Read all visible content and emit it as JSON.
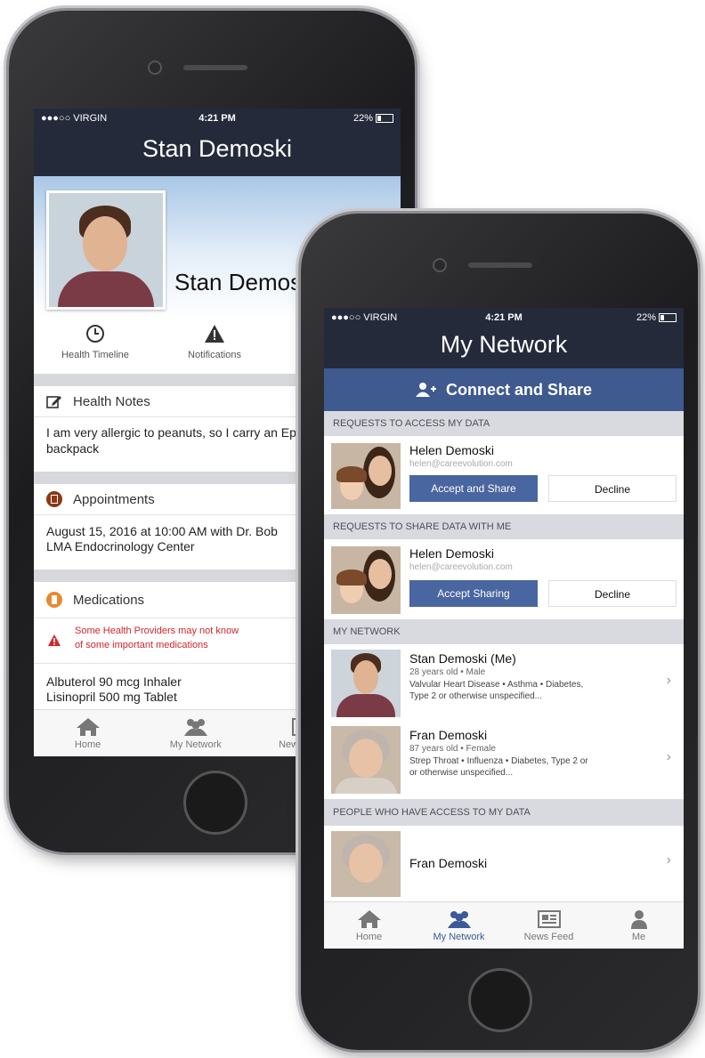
{
  "back_phone": {
    "status": {
      "carrier": "●●●○○ VIRGIN",
      "time": "4:21 PM",
      "battery": "22%"
    },
    "title": "Stan Demoski",
    "profile_name": "Stan Demoski",
    "quick_actions": [
      {
        "label": "Health Timeline",
        "icon": "clock-icon"
      },
      {
        "label": "Notifications",
        "icon": "warning-icon"
      }
    ],
    "health_notes": {
      "title": "Health Notes",
      "text": "I am very allergic to peanuts, so I carry an EpiPen in my backpack"
    },
    "appointments": {
      "title": "Appointments",
      "line1": "August 15, 2016 at 10:00 AM with Dr. Bob",
      "line2": "LMA Endocrinology Center"
    },
    "medications": {
      "title": "Medications",
      "warning_line1": "Some Health Providers may not know",
      "warning_line2": "of some important medications",
      "items": [
        "Albuterol 90 mcg Inhaler",
        "Lisinopril 500 mg Tablet"
      ]
    },
    "tabs": [
      "Home",
      "My Network",
      "News Feed"
    ]
  },
  "front_phone": {
    "status": {
      "carrier": "●●●○○ VIRGIN",
      "time": "4:21 PM",
      "battery": "22%"
    },
    "title": "My Network",
    "connect_label": "Connect and Share",
    "sections": {
      "requests_access": "REQUESTS TO ACCESS MY DATA",
      "requests_share": "REQUESTS TO SHARE DATA WITH ME",
      "my_network": "MY NETWORK",
      "people_access": "PEOPLE WHO HAVE ACCESS TO MY DATA"
    },
    "request1": {
      "name": "Helen Demoski",
      "email": "helen@careevolution.com",
      "accept": "Accept and Share",
      "decline": "Decline"
    },
    "request2": {
      "name": "Helen Demoski",
      "email": "helen@careevolution.com",
      "accept": "Accept Sharing",
      "decline": "Decline"
    },
    "network": [
      {
        "name": "Stan Demoski (Me)",
        "meta": "28 years old • Male",
        "conditions1": "Valvular Heart Disease • Asthma • Diabetes,",
        "conditions2": "Type 2 or otherwise unspecified..."
      },
      {
        "name": "Fran Demoski",
        "meta": "87 years old • Female",
        "conditions1": "Strep Throat • Influenza • Diabetes, Type 2 or",
        "conditions2": "or otherwise unspecified..."
      }
    ],
    "access": [
      {
        "name": "Fran Demoski"
      }
    ],
    "tabs": [
      "Home",
      "My Network",
      "News Feed",
      "Me"
    ]
  },
  "colors": {
    "navbar": "#252a3a",
    "accent": "#3f5a8f",
    "warning": "#d0262b",
    "orange": "#e58a2e"
  }
}
